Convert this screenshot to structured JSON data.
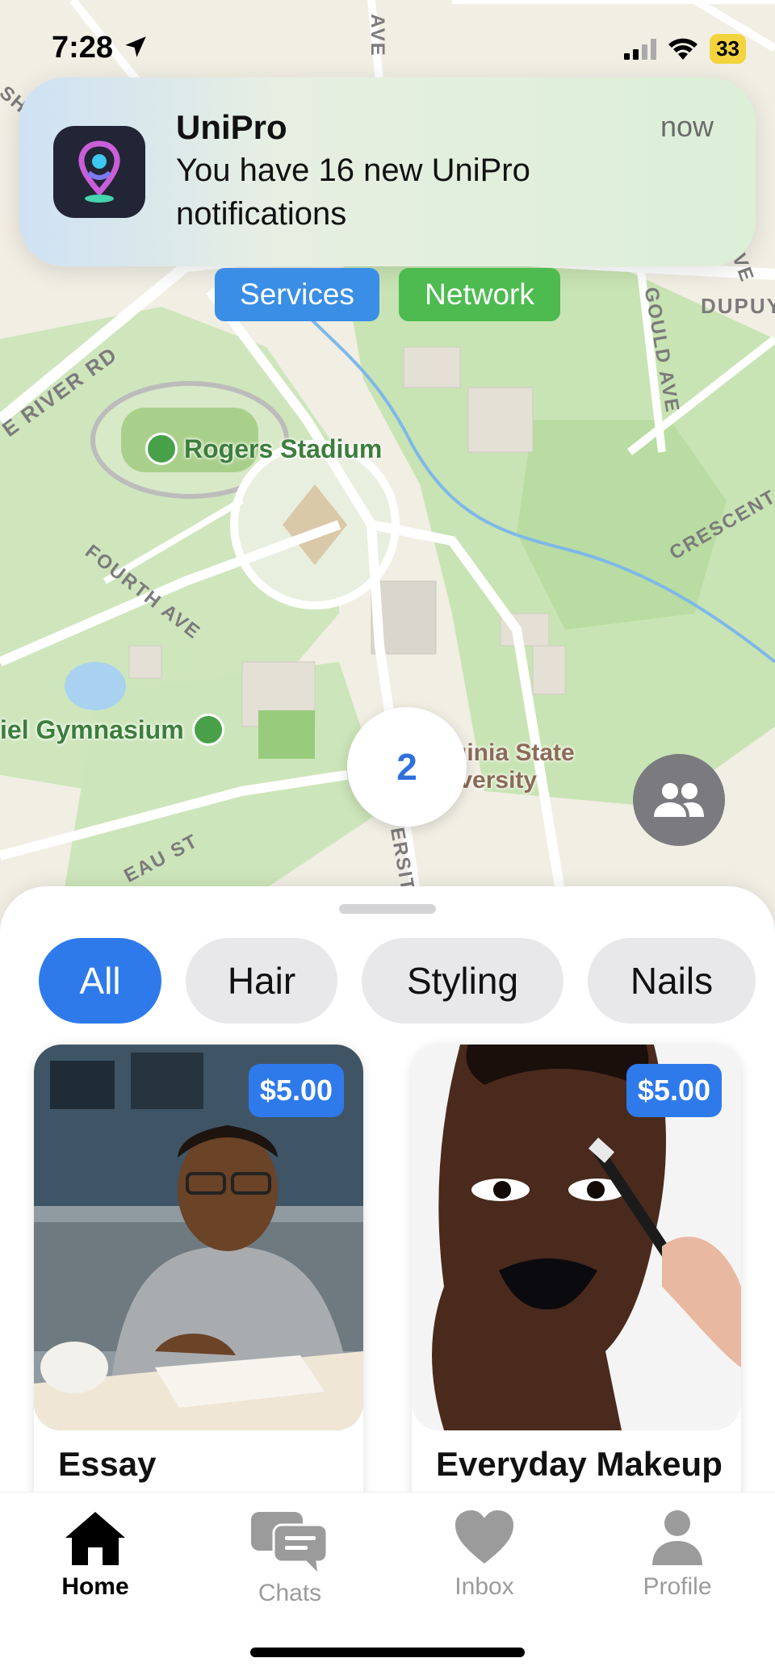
{
  "status_bar": {
    "time": "7:28",
    "battery": "33"
  },
  "notification": {
    "app": "UniPro",
    "time": "now",
    "message": "You have 16 new UniPro notifications"
  },
  "map": {
    "chips": [
      {
        "label": "Services",
        "color": "#3a8ee6"
      },
      {
        "label": "Network",
        "color": "#4dbb4f"
      }
    ],
    "pois": [
      "Rogers Stadium",
      "iel Gymnasium"
    ],
    "streets": [
      "E RIVER RD",
      "FOURTH AVE",
      "GOULD AVE",
      "CRESCENT A",
      "DUPUY",
      "AVE",
      "AVE",
      "EAU ST",
      "ERSITY",
      "SH"
    ],
    "campus_label": [
      "ginia State",
      "iversity"
    ],
    "cluster_count": "2"
  },
  "filters": [
    {
      "label": "All",
      "active": true
    },
    {
      "label": "Hair",
      "active": false
    },
    {
      "label": "Styling",
      "active": false
    },
    {
      "label": "Nails",
      "active": false
    }
  ],
  "listings": [
    {
      "title": "Essay",
      "price": "$5.00"
    },
    {
      "title": "Everyday Makeup",
      "price": "$5.00"
    }
  ],
  "tabs": [
    {
      "label": "Home",
      "icon": "home-icon",
      "active": true
    },
    {
      "label": "Chats",
      "icon": "chat-icon",
      "active": false
    },
    {
      "label": "Inbox",
      "icon": "heart-icon",
      "active": false
    },
    {
      "label": "Profile",
      "icon": "person-icon",
      "active": false
    }
  ],
  "colors": {
    "accent": "#2f7aeb",
    "services": "#3a8ee6",
    "network": "#4dbb4f"
  }
}
